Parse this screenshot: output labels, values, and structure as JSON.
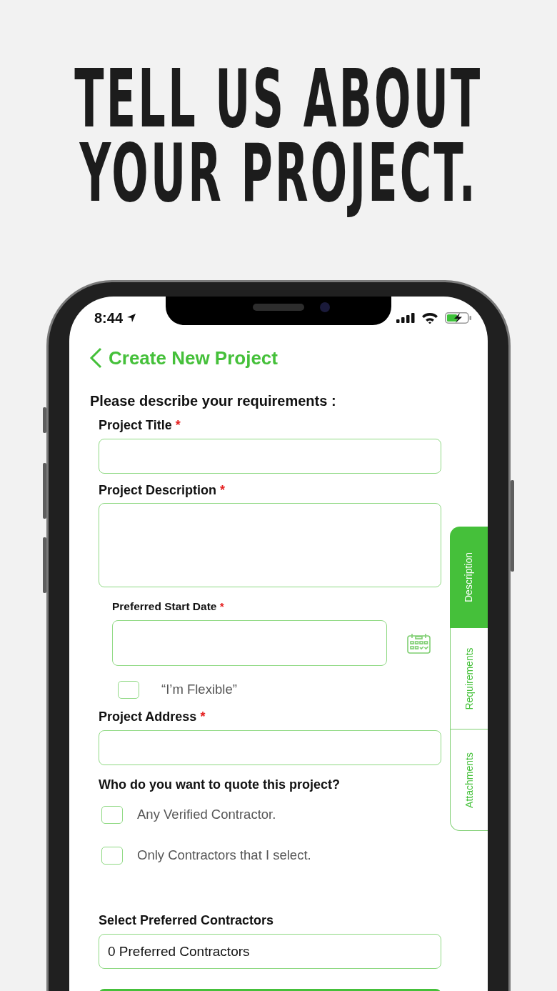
{
  "headline": [
    "TELL US ABOUT",
    "YOUR PROJECT."
  ],
  "status_bar": {
    "time": "8:44"
  },
  "nav": {
    "title": "Create New Project"
  },
  "form": {
    "heading": "Please describe your requirements :",
    "fields": [
      {
        "kind": "text",
        "label": "Project Title",
        "required_mark": "*"
      },
      {
        "kind": "textarea",
        "label": "Project Description",
        "required_mark": "*"
      },
      {
        "kind": "date",
        "label": "Preferred Start Date",
        "required_mark": "*",
        "flexible": {
          "label": "“I’m Flexible”",
          "checked": false
        }
      },
      {
        "kind": "text",
        "label": "Project Address",
        "required_mark": "*"
      }
    ],
    "question": "Who do you want to quote this project?",
    "options": [
      {
        "label": "Any Verified Contractor.",
        "checked": false
      },
      {
        "label": "Only Contractors that I select.",
        "checked": false
      }
    ],
    "preferred": {
      "label": "Select Preferred Contractors",
      "value": "0 Preferred Contractors"
    }
  },
  "side_tabs": [
    {
      "label": "Description",
      "selected": true
    },
    {
      "label": "Requirements",
      "selected": false
    },
    {
      "label": "Attachments",
      "selected": false
    }
  ]
}
